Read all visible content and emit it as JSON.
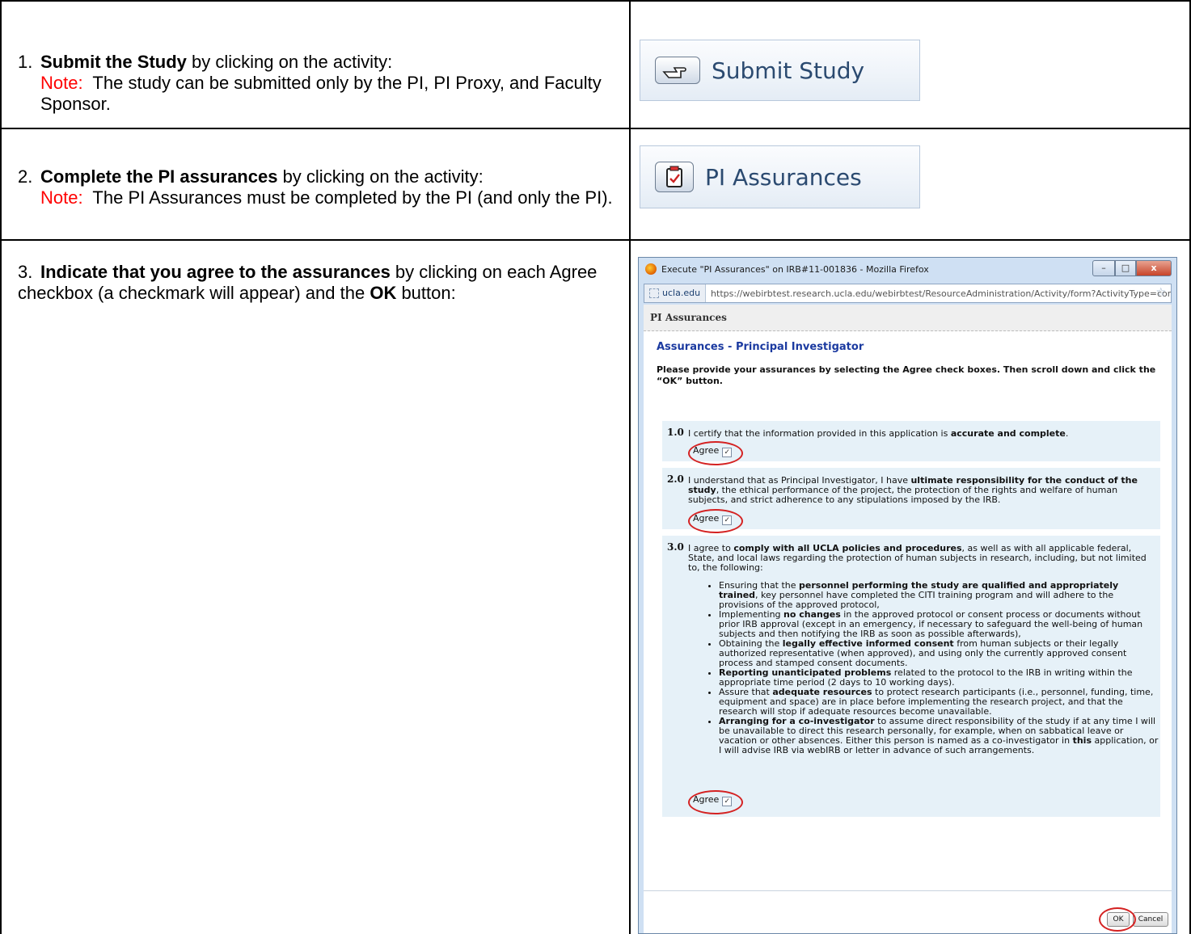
{
  "steps": [
    {
      "num": "1.",
      "bold": "Submit the Study",
      "rest": " by clicking on the activity:",
      "note_label": "Note:",
      "note_text": "The study can be submitted only by the PI, PI Proxy, and Faculty Sponsor."
    },
    {
      "num": "2.",
      "bold": "Complete the PI assurances",
      "rest": " by clicking on the activity:",
      "note_label": "Note:",
      "note_text": "The PI Assurances must be completed by the PI (and only the PI)."
    },
    {
      "num": "3.",
      "bold": "Indicate that you agree to the assurances",
      "rest": " by clicking on each Agree checkbox (a checkmark will appear) and the ",
      "bold2": "OK",
      "rest2": " button:"
    }
  ],
  "activities": {
    "submit_label": "Submit Study",
    "submit_icon": "pointing-hand-icon",
    "pi_label": "PI Assurances",
    "pi_icon": "clipboard-check-icon"
  },
  "window": {
    "title": "Execute \"PI Assurances\" on IRB#11-001836 - Mozilla Firefox",
    "site": "ucla.edu",
    "url": "https://webirbtest.research.ucla.edu/webirbtest/ResourceAdministration/Activity/form?ActivityType=com.w",
    "header": "PI Assurances",
    "title2": "Assurances - Principal Investigator",
    "intro": "Please provide your assurances by selecting the Agree check boxes. Then scroll down and click the “OK” button.",
    "items": [
      {
        "no": "1.0",
        "pre": "I certify that the information provided in this application is ",
        "b": "accurate and complete",
        "post": "."
      },
      {
        "no": "2.0",
        "pre": "I understand that as Principal Investigator, I have ",
        "b": "ultimate responsibility for the conduct of the study",
        "post": ", the ethical performance of the project, the protection of the rights and welfare of human subjects, and strict adherence to any stipulations imposed by the IRB."
      },
      {
        "no": "3.0",
        "pre": "I agree to ",
        "b": "comply with all UCLA policies and procedures",
        "post": ", as well as with all applicable federal, State, and local laws regarding the protection of human subjects in research, including, but not limited to, the following:"
      }
    ],
    "bullets": [
      {
        "pre": "Ensuring that the ",
        "b": "personnel performing the study are qualified and appropriately trained",
        "post": ", key personnel have completed the CITI training program and will adhere to the provisions of the approved protocol,"
      },
      {
        "pre": "Implementing ",
        "b": "no changes",
        "post": " in the approved protocol or consent process or documents without prior IRB approval (except in an emergency, if necessary to safeguard the well-being of human subjects and then notifying the IRB as soon as possible afterwards),"
      },
      {
        "pre": "Obtaining the ",
        "b": "legally effective informed consent",
        "post": " from human subjects or their legally authorized representative (when approved), and using only the currently approved consent process and stamped consent documents."
      },
      {
        "pre": "",
        "b": "Reporting unanticipated problems",
        "post": " related to the protocol to the IRB in writing within the appropriate time period (2 days to 10 working days)."
      },
      {
        "pre": "Assure that ",
        "b": "adequate resources",
        "post": " to protect research participants (i.e., personnel, funding, time, equipment and space) are in place before implementing the research project, and that the research will stop if adequate resources become unavailable."
      },
      {
        "pre": "",
        "b": "Arranging for a co-investigator",
        "post": " to assume direct responsibility of the study if at any time I will be unavailable to direct this research personally, for example, when on sabbatical leave or vacation or other absences. Either this person is named as a co-investigator in ",
        "b2": "this",
        "post2": " application, or I will advise IRB via webIRB or letter in advance of such arrangements."
      }
    ],
    "agree_label": "Agree",
    "ok_label": "OK",
    "cancel_label": "Cancel"
  }
}
